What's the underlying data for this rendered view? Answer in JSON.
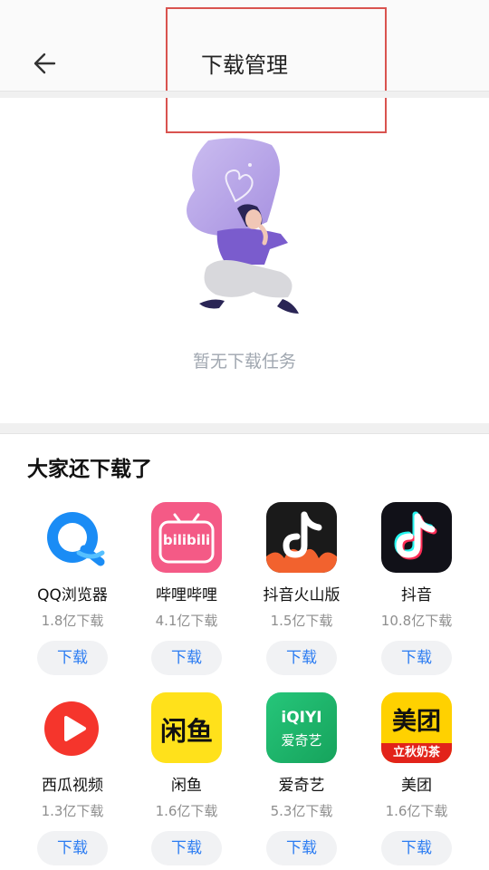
{
  "header": {
    "title": "下载管理"
  },
  "empty": {
    "text": "暂无下载任务"
  },
  "section": {
    "title": "大家还下载了"
  },
  "apps": [
    {
      "name": "QQ浏览器",
      "downloads": "1.8亿下载",
      "button": "下载",
      "icon": "qq-browser-icon"
    },
    {
      "name": "哔哩哔哩",
      "downloads": "4.1亿下载",
      "button": "下载",
      "icon": "bilibili-icon",
      "icon_text": "bilibili"
    },
    {
      "name": "抖音火山版",
      "downloads": "1.5亿下载",
      "button": "下载",
      "icon": "douyin-huoshan-icon"
    },
    {
      "name": "抖音",
      "downloads": "10.8亿下载",
      "button": "下载",
      "icon": "douyin-icon"
    },
    {
      "name": "西瓜视频",
      "downloads": "1.3亿下载",
      "button": "下载",
      "icon": "xigua-icon"
    },
    {
      "name": "闲鱼",
      "downloads": "1.6亿下载",
      "button": "下载",
      "icon": "xianyu-icon",
      "icon_text": "闲鱼"
    },
    {
      "name": "爱奇艺",
      "downloads": "5.3亿下载",
      "button": "下载",
      "icon": "iqiyi-icon",
      "icon_text": "iQIYI",
      "icon_subtext": "爱奇艺"
    },
    {
      "name": "美团",
      "downloads": "1.6亿下载",
      "button": "下载",
      "icon": "meituan-icon",
      "icon_text": "美团",
      "icon_subtext": "立秋奶茶"
    }
  ],
  "colors": {
    "accent": "#2b7cf2",
    "highlight": "#d9534f"
  }
}
